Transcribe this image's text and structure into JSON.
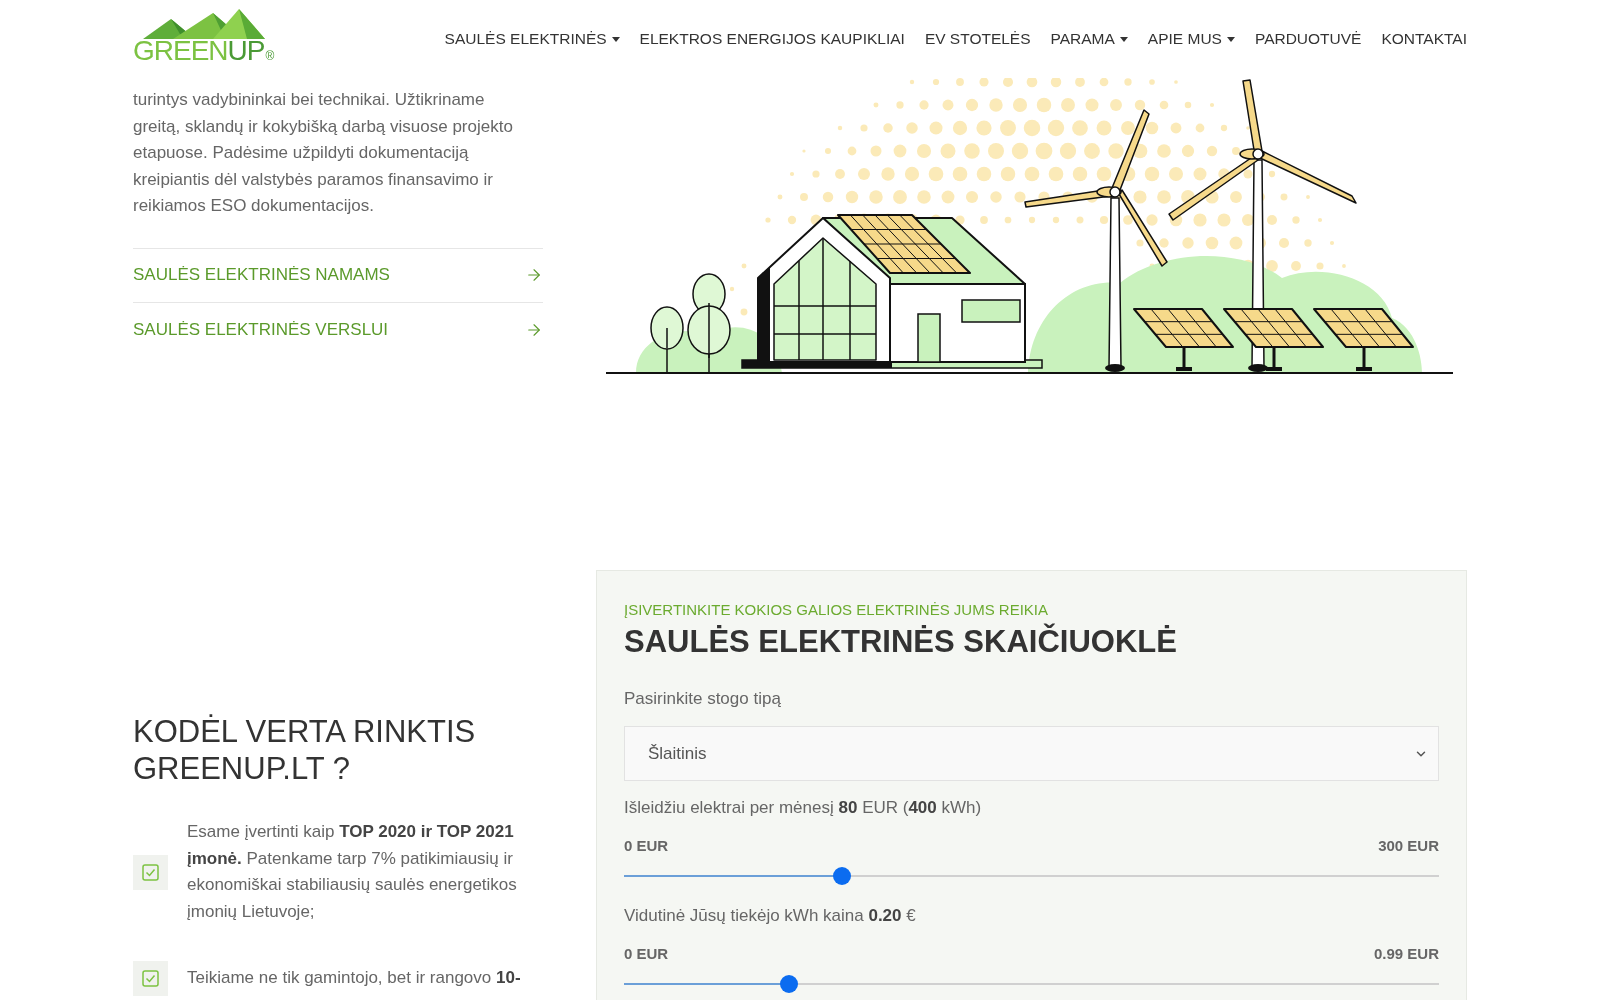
{
  "header": {
    "logo": {
      "text_light": "GREEN",
      "text_dark": "UP",
      "mark": "®"
    },
    "nav": [
      {
        "label": "SAULĖS ELEKTRINĖS",
        "dropdown": true
      },
      {
        "label": "ELEKTROS ENERGIJOS KAUPIKLIAI",
        "dropdown": false
      },
      {
        "label": "EV STOTELĖS",
        "dropdown": false
      },
      {
        "label": "PARAMA",
        "dropdown": true
      },
      {
        "label": "APIE MUS",
        "dropdown": true
      },
      {
        "label": "PARDUOTUVĖ",
        "dropdown": false
      },
      {
        "label": "KONTAKTAI",
        "dropdown": false
      }
    ]
  },
  "intro": {
    "paragraph": "turintys vadybininkai bei technikai. Užtikriname greitą, sklandų ir kokybišką darbą visuose projekto etapuose. Padėsime užpildyti dokumentaciją kreipiantis dėl valstybės paramos finansavimo ir reikiamos ESO dokumentacijos.",
    "links": [
      "SAULĖS ELEKTRINĖS NAMAMS",
      "SAULĖS ELEKTRINĖS VERSLUI"
    ]
  },
  "why": {
    "title": "KODĖL VERTA RINKTIS GREENUP.LT ?",
    "items": [
      "Esame įvertinti kaip **TOP 2020 ir TOP 2021 įmonė.** Patenkame tarp 7% patikimiausių ir ekonomiškai stabiliausių saulės energetikos įmonių Lietuvoje;",
      "Teikiame ne tik gamintojo, bet ir rangovo **10-**"
    ]
  },
  "calculator": {
    "eyebrow": "ĮSIVERTINKITE KOKIOS GALIOS ELEKTRINĖS JUMS REIKIA",
    "title": "SAULĖS ELEKTRINĖS SKAIČIUOKLĖ",
    "roof_label": "Pasirinkite stogo tipą",
    "roof_select": {
      "value": "Šlaitinis"
    },
    "sliders": [
      {
        "label": "Išleidžiu elektrai per mėnesį **80** EUR (**400** kWh)",
        "min_label": "0 EUR",
        "max_label": "300 EUR",
        "level": 0.267
      },
      {
        "label": "Vidutinė Jūsų tiekėjo kWh kaina **0.20** €",
        "min_label": "0 EUR",
        "max_label": "0.99 EUR",
        "level": 0.202
      }
    ]
  }
}
